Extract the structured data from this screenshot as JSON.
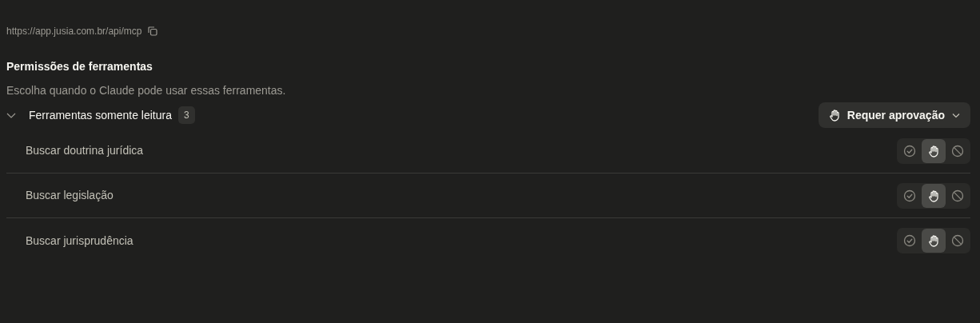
{
  "server_url": "https://app.jusia.com.br/api/mcp",
  "permissions": {
    "title": "Permissões de ferramentas",
    "description": "Escolha quando o Claude pode usar essas ferramentas."
  },
  "group": {
    "label": "Ferramentas somente leitura",
    "count": "3",
    "expanded": true,
    "policy_button": {
      "label": "Requer aprovação"
    }
  },
  "tools": [
    {
      "name": "Buscar doutrina jurídica",
      "options": [
        {
          "kind": "allow",
          "selected": false
        },
        {
          "kind": "approval",
          "selected": true
        },
        {
          "kind": "block",
          "selected": false
        }
      ]
    },
    {
      "name": "Buscar legislação",
      "options": [
        {
          "kind": "allow",
          "selected": false
        },
        {
          "kind": "approval",
          "selected": true
        },
        {
          "kind": "block",
          "selected": false
        }
      ]
    },
    {
      "name": "Buscar jurisprudência",
      "options": [
        {
          "kind": "allow",
          "selected": false
        },
        {
          "kind": "approval",
          "selected": true
        },
        {
          "kind": "block",
          "selected": false
        }
      ]
    }
  ]
}
